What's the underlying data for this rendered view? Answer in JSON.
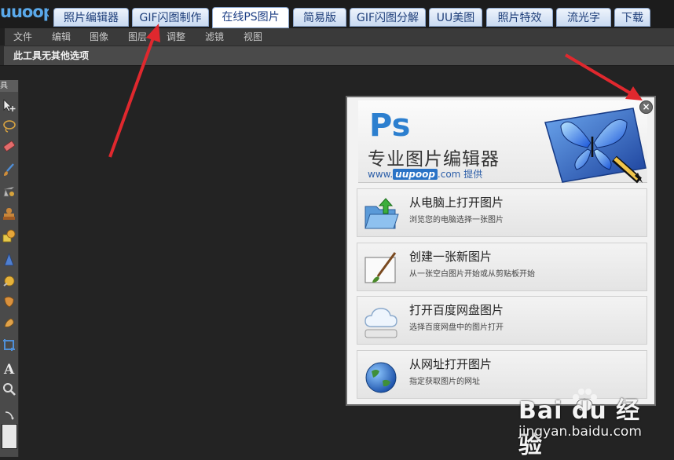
{
  "app": {
    "logo_text": "uuoop"
  },
  "nav": {
    "tabs": [
      {
        "label": "照片编辑器",
        "active": false
      },
      {
        "label": "GIF闪图制作",
        "active": false
      },
      {
        "label": "在线PS图片",
        "active": true
      },
      {
        "label": "简易版",
        "active": false
      },
      {
        "label": "GIF闪图分解",
        "active": false
      },
      {
        "label": "UU美图",
        "active": false
      },
      {
        "label": "照片特效",
        "active": false
      },
      {
        "label": "流光字",
        "active": false
      },
      {
        "label": "下载",
        "active": false
      }
    ]
  },
  "menu": {
    "items": [
      "文件",
      "编辑",
      "图像",
      "图层",
      "调整",
      "滤镜",
      "视图"
    ]
  },
  "options_bar": {
    "text": "此工具无其他选项"
  },
  "toolbox": {
    "header": "具",
    "tools": [
      "move-tool-icon",
      "lasso-tool-icon",
      "eraser-tool-icon",
      "brush-tool-icon",
      "clone-tool-icon",
      "stamp-tool-icon",
      "shape-tool-icon",
      "sharpen-tool-icon",
      "dodge-tool-icon",
      "burn-tool-icon",
      "smudge-tool-icon",
      "crop-tool-icon",
      "text-tool-icon",
      "zoom-tool-icon"
    ]
  },
  "dialog": {
    "banner": {
      "logo": "Ps",
      "title": "专业图片编辑器",
      "site_prefix": "www.",
      "site_brand": "uupoop",
      "site_suffix": ".com",
      "site_provided": "提供"
    },
    "close_label": "×",
    "options": [
      {
        "title": "从电脑上打开图片",
        "subtitle": "浏览您的电脑选择一张图片",
        "icon": "folder-open-icon"
      },
      {
        "title": "创建一张新图片",
        "subtitle": "从一张空白图片开始或从剪贴板开始",
        "icon": "paintbrush-canvas-icon"
      },
      {
        "title": "打开百度网盘图片",
        "subtitle": "选择百度网盘中的图片打开",
        "icon": "cloud-drive-icon"
      },
      {
        "title": "从网址打开图片",
        "subtitle": "指定获取图片的网址",
        "icon": "globe-icon"
      }
    ]
  },
  "watermark": {
    "text": "Bai du 经验",
    "sub": "jingyan.baidu.com"
  },
  "colors": {
    "arrow": "#e0282e",
    "accent": "#2c7fcf",
    "tab_text": "#1f3f7a"
  }
}
